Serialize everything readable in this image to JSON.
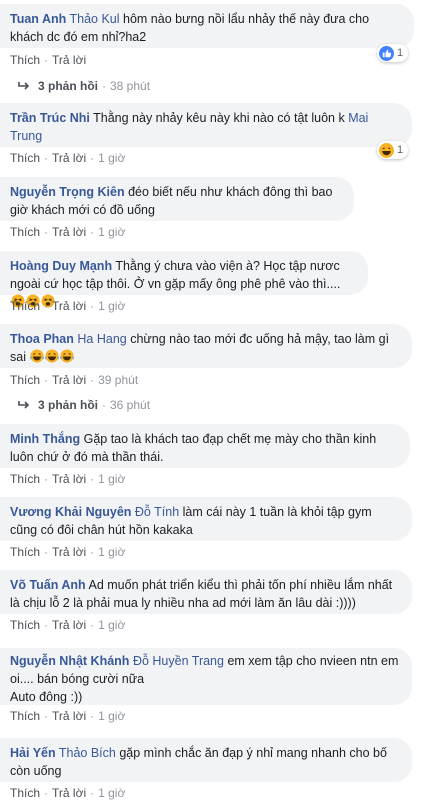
{
  "comments": [
    {
      "author": "Tuan Anh",
      "tag": "Thảo Kul",
      "text": "hôm nào bưng nồi lẩu nhảy thế này đưa cho khách dc đó em nhỉ?ha2",
      "like": "Thích",
      "reply": "Trả lời",
      "reaction_count": "1",
      "reaction_icon": "like-reaction-icon",
      "replies_label": "3 phản hồi",
      "replies_time": "38 phút"
    },
    {
      "author": "Trần Trúc Nhi",
      "text_before_tag": "Thằng này nhảy kêu này khi nào có tật luôn k",
      "tag": "Mai Trung",
      "like": "Thích",
      "reply": "Trả lời",
      "time": "1 giờ",
      "reaction_count": "1",
      "reaction_icon": "haha-reaction-icon"
    },
    {
      "author": "Nguyễn Trọng Kiên",
      "text": "đéo biết nếu như khách đông thì bao giờ khách mới có đồ uống",
      "like": "Thích",
      "reply": "Trả lời",
      "time": "1 giờ"
    },
    {
      "author": "Hoàng Duy Mạnh",
      "text": "Thằng ý chưa vào viện à? Học tập nươc ngoài cứ học tập thôi. Ở vn gặp mấy ông phê phê vào thì....",
      "emoji": "tired-face-emoji",
      "like": "Thích",
      "reply": "Trả lời",
      "time": "1 giờ"
    },
    {
      "author": "Thoa Phan",
      "tag": "Ha Hang",
      "text": "chừng nào tao mới đc uống hả mậy, tao làm gì sai",
      "emoji": "laughing-emoji",
      "like": "Thích",
      "reply": "Trả lời",
      "time": "39 phút",
      "replies_label": "3 phản hồi",
      "replies_time": "36 phút"
    },
    {
      "author": "Minh Thắng",
      "text": "Gặp tao là khách tao đạp chết mẹ mày cho thần kinh luôn chứ ở đó mà thần thái.",
      "like": "Thích",
      "reply": "Trả lời",
      "time": "1 giờ"
    },
    {
      "author": "Vương Khải Nguyên",
      "tag": "Đỗ Tính",
      "text": "làm cái này 1 tuần là khỏi tập gym cũng có đôi chân hút hồn kakaka",
      "like": "Thích",
      "reply": "Trả lời",
      "time": "1 giờ"
    },
    {
      "author": "Võ Tuấn Anh",
      "text": "Ad muốn phát triển kiểu thì phải tốn phí nhiều lắm nhất là chịu lỗ 2 là phải mua ly nhiều nha ad mới làm ăn lâu dài :))))",
      "like": "Thích",
      "reply": "Trả lời",
      "time": "1 giờ"
    },
    {
      "author": "Nguyễn Nhật Khánh",
      "tag": "Đỗ Huyền Trang",
      "text": "em xem tập cho nvieen ntn em oi.... bán bóng cười nữa",
      "line2": "Auto đông :))",
      "like": "Thích",
      "reply": "Trả lời",
      "time": "1 giờ"
    },
    {
      "author": "Hải Yến",
      "tag": "Thảo Bích",
      "text": "gặp mình chắc ăn đạp ý nhỉ mang nhanh cho bố còn uống",
      "like": "Thích",
      "reply": "Trả lời",
      "time": "1 giờ"
    }
  ],
  "colors": {
    "link": "#385898",
    "bubble": "#f2f3f5",
    "meta": "#90949c",
    "like_blue": "#4080ff",
    "haha_yellow": "#f7b125"
  }
}
